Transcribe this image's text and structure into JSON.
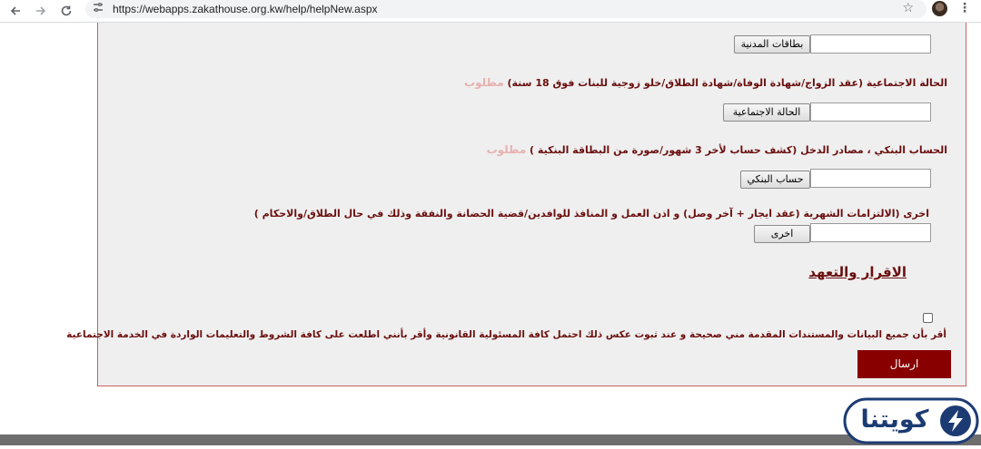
{
  "browser": {
    "url": "https://webapps.zakathouse.org.kw/help/helpNew.aspx",
    "back_icon": "arrow-left-icon",
    "forward_icon": "arrow-right-icon",
    "reload_icon": "reload-icon",
    "site_info_icon": "tune-icon",
    "bookmark_icon": "star-icon"
  },
  "form": {
    "civil_id": {
      "button_label": "بطاقات المدنية"
    },
    "social_status": {
      "label": "الحالة الاجتماعية (عقد الزواج/شهادة الوفاة/شهادة الطلاق/خلو زوجية للبنات فوق 18 سنة)",
      "required": "مطلوب",
      "button_label": "الحالة الاجتماعية"
    },
    "bank_account": {
      "label": "الحساب البنكي ، مصادر الدخل (كشف حساب لأخر 3 شهور/صورة من البطاقة البنكية )",
      "required": "مطلوب",
      "button_label": "حساب البنكي"
    },
    "other": {
      "label": "اخرى (الالتزامات الشهرية (عقد ايجار + آخر وصل) و اذن العمل و المنافذ للوافدين/قضية الحضانة والنفقة وذلك في حال الطلاق/والاحكام )",
      "button_label": "اخرى"
    },
    "declaration": {
      "title": "الاقرار والتعهد",
      "text": "أقر بأن جميع البيانات والمستندات المقدمة مني صحيحة و عند ثبوت عكس ذلك احتمل كافة المسئولية القانونية وأقر بأنني اطلعت على كافة الشروط والتعليمات الواردة في الخدمة الاجتماعية",
      "checked": false
    },
    "submit_label": "ارسال"
  },
  "watermark": {
    "text": "كويتنا"
  },
  "colors": {
    "label": "#6b0f0f",
    "required": "#e8b1b1",
    "submit_bg": "#880000",
    "panel_border": "#c96060",
    "panel_bg": "#efefef",
    "logo": "#1d3b73"
  }
}
